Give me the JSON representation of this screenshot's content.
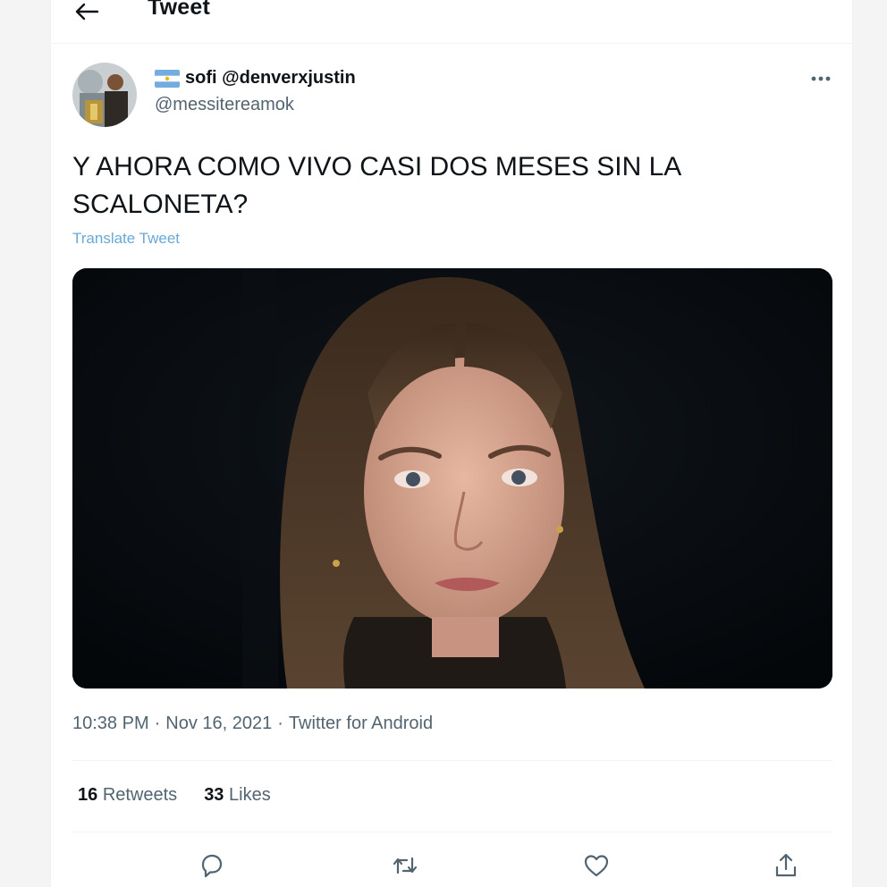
{
  "header": {
    "title": "Tweet",
    "back_icon": "arrow-left-icon"
  },
  "author": {
    "display_name": "sofi @denverxjustin",
    "handle": "@messitereamok",
    "flag_icon": "argentina-flag-icon",
    "avatar_icon": "avatar"
  },
  "tweet": {
    "text": "Y AHORA COMO VIVO CASI DOS MESES SIN LA SCALONETA?",
    "translate_label": "Translate Tweet",
    "time": "10:38 PM",
    "date": "Nov 16, 2021",
    "source": "Twitter for Android",
    "separator": "·"
  },
  "stats": {
    "retweets_count": "16",
    "retweets_label": "Retweets",
    "likes_count": "33",
    "likes_label": "Likes"
  },
  "actions": [
    {
      "icon": "reply-icon"
    },
    {
      "icon": "retweet-icon"
    },
    {
      "icon": "like-icon"
    },
    {
      "icon": "share-icon"
    }
  ],
  "colors": {
    "accent_link": "#6aa8d8",
    "secondary_text": "#536471",
    "primary_text": "#0f1419"
  }
}
